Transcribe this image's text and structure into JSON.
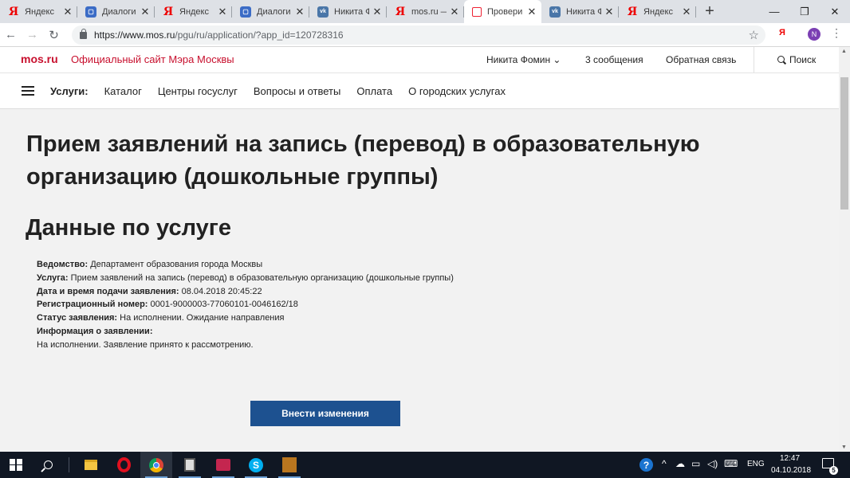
{
  "browser": {
    "tabs": [
      {
        "icon": "yandex-icon",
        "title": "Яндекс",
        "active": false
      },
      {
        "icon": "dialogs-icon",
        "title": "Диалоги",
        "active": false
      },
      {
        "icon": "yandex-icon",
        "title": "Яндекс",
        "active": false
      },
      {
        "icon": "dialogs-icon",
        "title": "Диалоги",
        "active": false
      },
      {
        "icon": "vk-icon",
        "title": "Никита Ф",
        "active": false
      },
      {
        "icon": "yandex-icon",
        "title": "mos.ru —",
        "active": false
      },
      {
        "icon": "document-icon",
        "title": "Провери",
        "active": true
      },
      {
        "icon": "vk-icon",
        "title": "Никита Ф",
        "active": false
      },
      {
        "icon": "yandex-icon",
        "title": "Яндекс",
        "active": false
      }
    ],
    "tab_close_glyph": "✕",
    "new_tab_glyph": "+",
    "window_controls": {
      "minimize": "—",
      "restore": "❐",
      "close": "✕"
    },
    "nav": {
      "back": "←",
      "forward": "→",
      "reload": "↻"
    },
    "url_host": "https://www.mos.ru",
    "url_path": "/pgu/ru/application/?app_id=120728316",
    "star_glyph": "☆",
    "extension_label": "Я",
    "profile_initial": "N",
    "menu_glyph": "⋮"
  },
  "site_header": {
    "logo": "mos.ru",
    "tagline": "Официальный сайт Мэра Москвы",
    "user_name": "Никита Фомин ⌄",
    "messages": "3 сообщения",
    "feedback": "Обратная связь",
    "search_label": "Поиск"
  },
  "services_nav": {
    "label": "Услуги:",
    "links": [
      "Каталог",
      "Центры госуслуг",
      "Вопросы и ответы",
      "Оплата",
      "О городских услугах"
    ]
  },
  "main": {
    "title": "Прием заявлений на запись (перевод) в образовательную организацию (дошкольные группы)",
    "section_title": "Данные по услуге",
    "details": [
      {
        "label": "Ведомство:",
        "value": "Департамент образования города Москвы"
      },
      {
        "label": "Услуга:",
        "value": "Прием заявлений на запись (перевод) в образовательную организацию (дошкольные группы)"
      },
      {
        "label": "Дата и время подачи заявления:",
        "value": "08.04.2018 20:45:22"
      },
      {
        "label": "Регистрационный номер:",
        "value": "0001-9000003-77060101-0046162/18"
      },
      {
        "label": "Статус заявления:",
        "value": "На исполнении. Ожидание направления"
      },
      {
        "label": "Информация о заявлении:",
        "value": ""
      }
    ],
    "info_text": "На исполнении. Заявление принято к рассмотрению.",
    "edit_button": "Внести изменения"
  },
  "scrollbar": {
    "up": "▲",
    "down": "▼"
  },
  "taskbar": {
    "apps": [
      "start-icon",
      "search-icon",
      "file-explorer-icon",
      "opera-icon",
      "chrome-icon",
      "calculator-icon",
      "photos-icon",
      "skype-icon",
      "game-icon"
    ],
    "skype_glyph": "S",
    "help_glyph": "?",
    "tray_glyphs": {
      "chevron": "^",
      "cloud": "☁",
      "network": "▭",
      "volume": "◁)",
      "keyboard": "⌨"
    },
    "language": "ENG",
    "time": "12:47",
    "date": "04.10.2018",
    "notification_count": "5"
  },
  "colors": {
    "brand_red": "#c8102e",
    "button_blue": "#1d5190",
    "taskbar": "#101723"
  }
}
